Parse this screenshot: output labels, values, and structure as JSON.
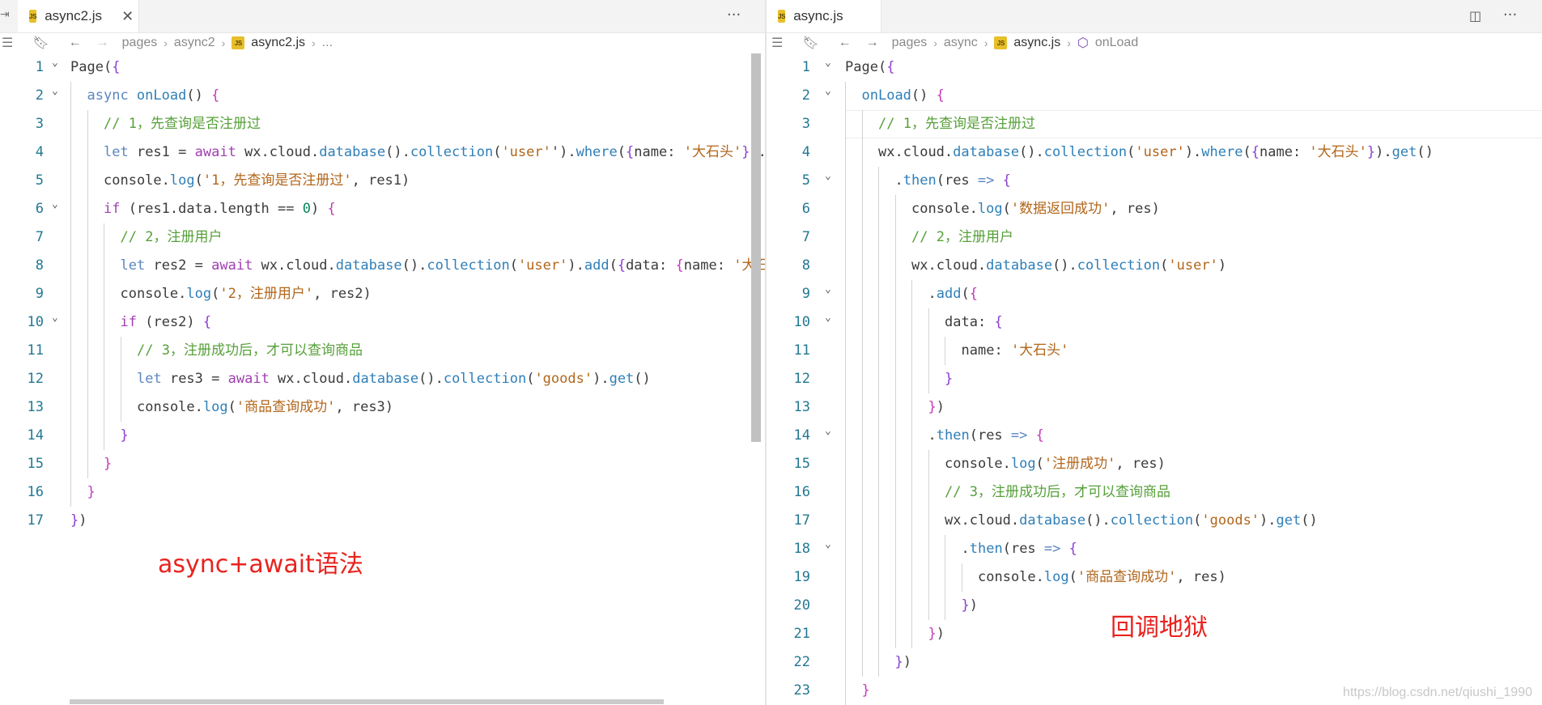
{
  "left": {
    "tab": {
      "icon": "JS",
      "label": "async2.js",
      "close": "✕"
    },
    "more": "···",
    "breadcrumb": [
      "pages",
      "async2",
      "async2.js",
      "..."
    ],
    "lines": [
      {
        "n": "1",
        "indent": 0,
        "fold": true,
        "tokens": [
          [
            "id",
            "Page"
          ],
          [
            "pun",
            "("
          ],
          [
            "b1",
            "{"
          ]
        ]
      },
      {
        "n": "2",
        "indent": 1,
        "fold": true,
        "tokens": [
          [
            "kw",
            "async "
          ],
          [
            "fn",
            "onLoad"
          ],
          [
            "pun",
            "() "
          ],
          [
            "b2",
            "{"
          ]
        ]
      },
      {
        "n": "3",
        "indent": 2,
        "fold": false,
        "tokens": [
          [
            "com",
            "// 1，先查询是否注册过"
          ]
        ]
      },
      {
        "n": "4",
        "indent": 2,
        "fold": false,
        "tokens": [
          [
            "kw",
            "let "
          ],
          [
            "id",
            "res1 "
          ],
          [
            "pun",
            "= "
          ],
          [
            "key",
            "await "
          ],
          [
            "id",
            "wx"
          ],
          [
            "pun",
            "."
          ],
          [
            "id",
            "cloud"
          ],
          [
            "pun",
            "."
          ],
          [
            "fn",
            "database"
          ],
          [
            "pun",
            "()."
          ],
          [
            "fn",
            "collection"
          ],
          [
            "pun",
            "("
          ],
          [
            "str",
            "'user'"
          ],
          [
            "pun",
            "')."
          ],
          [
            "fn",
            "where"
          ],
          [
            "pun",
            "("
          ],
          [
            "b1",
            "{"
          ],
          [
            "id",
            "name"
          ],
          [
            "pun",
            ": "
          ],
          [
            "str",
            "'大石头'"
          ],
          [
            "b1",
            "}"
          ],
          [
            "pun",
            ")."
          ]
        ]
      },
      {
        "n": "5",
        "indent": 2,
        "fold": false,
        "tokens": [
          [
            "id",
            "console"
          ],
          [
            "pun",
            "."
          ],
          [
            "fn",
            "log"
          ],
          [
            "pun",
            "("
          ],
          [
            "str",
            "'1，先查询是否注册过'"
          ],
          [
            "pun",
            ", "
          ],
          [
            "id",
            "res1"
          ],
          [
            "pun",
            ")"
          ]
        ]
      },
      {
        "n": "6",
        "indent": 2,
        "fold": true,
        "tokens": [
          [
            "key",
            "if "
          ],
          [
            "pun",
            "("
          ],
          [
            "id",
            "res1"
          ],
          [
            "pun",
            "."
          ],
          [
            "id",
            "data"
          ],
          [
            "pun",
            "."
          ],
          [
            "id",
            "length "
          ],
          [
            "pun",
            "== "
          ],
          [
            "num",
            "0"
          ],
          [
            "pun",
            ") "
          ],
          [
            "b2",
            "{"
          ]
        ]
      },
      {
        "n": "7",
        "indent": 3,
        "fold": false,
        "tokens": [
          [
            "com",
            "// 2，注册用户"
          ]
        ]
      },
      {
        "n": "8",
        "indent": 3,
        "fold": false,
        "tokens": [
          [
            "kw",
            "let "
          ],
          [
            "id",
            "res2 "
          ],
          [
            "pun",
            "= "
          ],
          [
            "key",
            "await "
          ],
          [
            "id",
            "wx"
          ],
          [
            "pun",
            "."
          ],
          [
            "id",
            "cloud"
          ],
          [
            "pun",
            "."
          ],
          [
            "fn",
            "database"
          ],
          [
            "pun",
            "()."
          ],
          [
            "fn",
            "collection"
          ],
          [
            "pun",
            "("
          ],
          [
            "str",
            "'user'"
          ],
          [
            "pun",
            ")."
          ],
          [
            "fn",
            "add"
          ],
          [
            "pun",
            "("
          ],
          [
            "b1",
            "{"
          ],
          [
            "id",
            "data"
          ],
          [
            "pun",
            ": "
          ],
          [
            "b2",
            "{"
          ],
          [
            "id",
            "name"
          ],
          [
            "pun",
            ": "
          ],
          [
            "str",
            "'大石头'"
          ]
        ]
      },
      {
        "n": "9",
        "indent": 3,
        "fold": false,
        "tokens": [
          [
            "id",
            "console"
          ],
          [
            "pun",
            "."
          ],
          [
            "fn",
            "log"
          ],
          [
            "pun",
            "("
          ],
          [
            "str",
            "'2，注册用户'"
          ],
          [
            "pun",
            ", "
          ],
          [
            "id",
            "res2"
          ],
          [
            "pun",
            ")"
          ]
        ]
      },
      {
        "n": "10",
        "indent": 3,
        "fold": true,
        "tokens": [
          [
            "key",
            "if "
          ],
          [
            "pun",
            "("
          ],
          [
            "id",
            "res2"
          ],
          [
            "pun",
            ") "
          ],
          [
            "b1",
            "{"
          ]
        ]
      },
      {
        "n": "11",
        "indent": 4,
        "fold": false,
        "tokens": [
          [
            "com",
            "// 3，注册成功后，才可以查询商品"
          ]
        ]
      },
      {
        "n": "12",
        "indent": 4,
        "fold": false,
        "tokens": [
          [
            "kw",
            "let "
          ],
          [
            "id",
            "res3 "
          ],
          [
            "pun",
            "= "
          ],
          [
            "key",
            "await "
          ],
          [
            "id",
            "wx"
          ],
          [
            "pun",
            "."
          ],
          [
            "id",
            "cloud"
          ],
          [
            "pun",
            "."
          ],
          [
            "fn",
            "database"
          ],
          [
            "pun",
            "()."
          ],
          [
            "fn",
            "collection"
          ],
          [
            "pun",
            "("
          ],
          [
            "str",
            "'goods'"
          ],
          [
            "pun",
            ")."
          ],
          [
            "fn",
            "get"
          ],
          [
            "pun",
            "()"
          ]
        ]
      },
      {
        "n": "13",
        "indent": 4,
        "fold": false,
        "tokens": [
          [
            "id",
            "console"
          ],
          [
            "pun",
            "."
          ],
          [
            "fn",
            "log"
          ],
          [
            "pun",
            "("
          ],
          [
            "str",
            "'商品查询成功'"
          ],
          [
            "pun",
            ", "
          ],
          [
            "id",
            "res3"
          ],
          [
            "pun",
            ")"
          ]
        ]
      },
      {
        "n": "14",
        "indent": 3,
        "fold": false,
        "tokens": [
          [
            "b1",
            "}"
          ]
        ]
      },
      {
        "n": "15",
        "indent": 2,
        "fold": false,
        "tokens": [
          [
            "b2",
            "}"
          ]
        ]
      },
      {
        "n": "16",
        "indent": 1,
        "fold": false,
        "tokens": [
          [
            "b2",
            "}"
          ]
        ]
      },
      {
        "n": "17",
        "indent": 0,
        "fold": false,
        "tokens": [
          [
            "b1",
            "}"
          ],
          [
            "pun",
            ")"
          ]
        ]
      }
    ],
    "annotation": "async+await语法"
  },
  "right": {
    "tab": {
      "icon": "JS",
      "label": "async.js"
    },
    "more": "···",
    "breadcrumb": [
      "pages",
      "async",
      "async.js",
      "onLoad"
    ],
    "lines": [
      {
        "n": "1",
        "indent": 0,
        "fold": true,
        "tokens": [
          [
            "id",
            "Page"
          ],
          [
            "pun",
            "("
          ],
          [
            "b1",
            "{"
          ]
        ]
      },
      {
        "n": "2",
        "indent": 1,
        "fold": true,
        "tokens": [
          [
            "fn",
            "onLoad"
          ],
          [
            "pun",
            "() "
          ],
          [
            "b2",
            "{"
          ]
        ]
      },
      {
        "n": "3",
        "indent": 2,
        "fold": false,
        "tokens": [
          [
            "com",
            "// 1，先查询是否注册过"
          ]
        ]
      },
      {
        "n": "4",
        "indent": 2,
        "fold": false,
        "tokens": [
          [
            "id",
            "wx"
          ],
          [
            "pun",
            "."
          ],
          [
            "id",
            "cloud"
          ],
          [
            "pun",
            "."
          ],
          [
            "fn",
            "database"
          ],
          [
            "pun",
            "()."
          ],
          [
            "fn",
            "collection"
          ],
          [
            "pun",
            "("
          ],
          [
            "str",
            "'user'"
          ],
          [
            "pun",
            ")."
          ],
          [
            "fn",
            "where"
          ],
          [
            "pun",
            "("
          ],
          [
            "b1",
            "{"
          ],
          [
            "id",
            "name"
          ],
          [
            "pun",
            ": "
          ],
          [
            "str",
            "'大石头'"
          ],
          [
            "b1",
            "}"
          ],
          [
            "pun",
            ")."
          ],
          [
            "fn",
            "get"
          ],
          [
            "pun",
            "()"
          ]
        ]
      },
      {
        "n": "5",
        "indent": 3,
        "fold": true,
        "tokens": [
          [
            "pun",
            "."
          ],
          [
            "fn",
            "then"
          ],
          [
            "pun",
            "("
          ],
          [
            "id",
            "res "
          ],
          [
            "kw",
            "=> "
          ],
          [
            "b1",
            "{"
          ]
        ]
      },
      {
        "n": "6",
        "indent": 4,
        "fold": false,
        "tokens": [
          [
            "id",
            "console"
          ],
          [
            "pun",
            "."
          ],
          [
            "fn",
            "log"
          ],
          [
            "pun",
            "("
          ],
          [
            "str",
            "'数据返回成功'"
          ],
          [
            "pun",
            ", "
          ],
          [
            "id",
            "res"
          ],
          [
            "pun",
            ")"
          ]
        ]
      },
      {
        "n": "7",
        "indent": 4,
        "fold": false,
        "tokens": [
          [
            "com",
            "// 2，注册用户"
          ]
        ]
      },
      {
        "n": "8",
        "indent": 4,
        "fold": false,
        "tokens": [
          [
            "id",
            "wx"
          ],
          [
            "pun",
            "."
          ],
          [
            "id",
            "cloud"
          ],
          [
            "pun",
            "."
          ],
          [
            "fn",
            "database"
          ],
          [
            "pun",
            "()."
          ],
          [
            "fn",
            "collection"
          ],
          [
            "pun",
            "("
          ],
          [
            "str",
            "'user'"
          ],
          [
            "pun",
            ")"
          ]
        ]
      },
      {
        "n": "9",
        "indent": 5,
        "fold": true,
        "tokens": [
          [
            "pun",
            "."
          ],
          [
            "fn",
            "add"
          ],
          [
            "pun",
            "("
          ],
          [
            "b2",
            "{"
          ]
        ]
      },
      {
        "n": "10",
        "indent": 6,
        "fold": true,
        "tokens": [
          [
            "id",
            "data"
          ],
          [
            "pun",
            ": "
          ],
          [
            "b1",
            "{"
          ]
        ]
      },
      {
        "n": "11",
        "indent": 7,
        "fold": false,
        "tokens": [
          [
            "id",
            "name"
          ],
          [
            "pun",
            ": "
          ],
          [
            "str",
            "'大石头'"
          ]
        ]
      },
      {
        "n": "12",
        "indent": 6,
        "fold": false,
        "tokens": [
          [
            "b1",
            "}"
          ]
        ]
      },
      {
        "n": "13",
        "indent": 5,
        "fold": false,
        "tokens": [
          [
            "b2",
            "}"
          ],
          [
            "pun",
            ")"
          ]
        ]
      },
      {
        "n": "14",
        "indent": 5,
        "fold": true,
        "tokens": [
          [
            "pun",
            "."
          ],
          [
            "fn",
            "then"
          ],
          [
            "pun",
            "("
          ],
          [
            "id",
            "res "
          ],
          [
            "kw",
            "=> "
          ],
          [
            "b2",
            "{"
          ]
        ]
      },
      {
        "n": "15",
        "indent": 6,
        "fold": false,
        "tokens": [
          [
            "id",
            "console"
          ],
          [
            "pun",
            "."
          ],
          [
            "fn",
            "log"
          ],
          [
            "pun",
            "("
          ],
          [
            "str",
            "'注册成功'"
          ],
          [
            "pun",
            ", "
          ],
          [
            "id",
            "res"
          ],
          [
            "pun",
            ")"
          ]
        ]
      },
      {
        "n": "16",
        "indent": 6,
        "fold": false,
        "tokens": [
          [
            "com",
            "// 3，注册成功后，才可以查询商品"
          ]
        ]
      },
      {
        "n": "17",
        "indent": 6,
        "fold": false,
        "tokens": [
          [
            "id",
            "wx"
          ],
          [
            "pun",
            "."
          ],
          [
            "id",
            "cloud"
          ],
          [
            "pun",
            "."
          ],
          [
            "fn",
            "database"
          ],
          [
            "pun",
            "()."
          ],
          [
            "fn",
            "collection"
          ],
          [
            "pun",
            "("
          ],
          [
            "str",
            "'goods'"
          ],
          [
            "pun",
            ")."
          ],
          [
            "fn",
            "get"
          ],
          [
            "pun",
            "()"
          ]
        ]
      },
      {
        "n": "18",
        "indent": 7,
        "fold": true,
        "tokens": [
          [
            "pun",
            "."
          ],
          [
            "fn",
            "then"
          ],
          [
            "pun",
            "("
          ],
          [
            "id",
            "res "
          ],
          [
            "kw",
            "=> "
          ],
          [
            "b1",
            "{"
          ]
        ]
      },
      {
        "n": "19",
        "indent": 8,
        "fold": false,
        "tokens": [
          [
            "id",
            "console"
          ],
          [
            "pun",
            "."
          ],
          [
            "fn",
            "log"
          ],
          [
            "pun",
            "("
          ],
          [
            "str",
            "'商品查询成功'"
          ],
          [
            "pun",
            ", "
          ],
          [
            "id",
            "res"
          ],
          [
            "pun",
            ")"
          ]
        ]
      },
      {
        "n": "20",
        "indent": 7,
        "fold": false,
        "tokens": [
          [
            "b1",
            "}"
          ],
          [
            "pun",
            ")"
          ]
        ]
      },
      {
        "n": "21",
        "indent": 5,
        "fold": false,
        "tokens": [
          [
            "b2",
            "}"
          ],
          [
            "pun",
            ")"
          ]
        ]
      },
      {
        "n": "22",
        "indent": 3,
        "fold": false,
        "tokens": [
          [
            "b1",
            "}"
          ],
          [
            "pun",
            ")"
          ]
        ]
      },
      {
        "n": "23",
        "indent": 1,
        "fold": false,
        "tokens": [
          [
            "b2",
            "}"
          ]
        ]
      }
    ],
    "annotation": "回调地狱"
  },
  "watermark": "https://blog.csdn.net/qiushi_1990"
}
